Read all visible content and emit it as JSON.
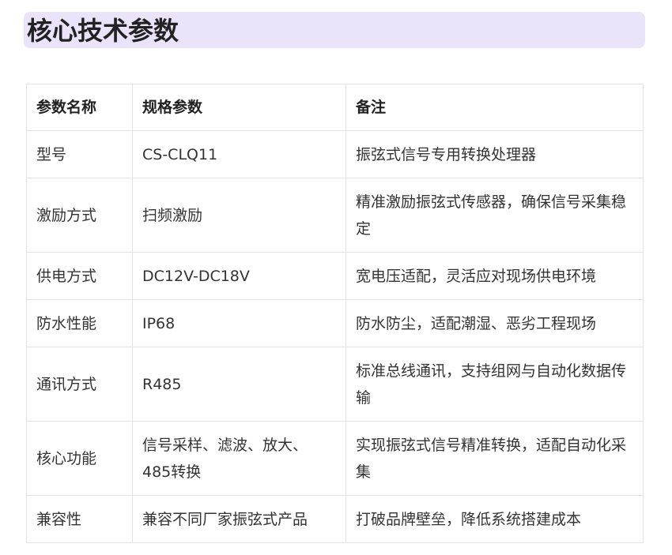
{
  "section": {
    "title": "核心技术参数"
  },
  "table": {
    "headers": [
      "参数名称",
      "规格参数",
      "备注"
    ],
    "rows": [
      {
        "name": "型号",
        "spec": "CS-CLQ11",
        "note": "振弦式信号专用转换处理器"
      },
      {
        "name": "激励方式",
        "spec": "扫频激励",
        "note": "精准激励振弦式传感器，确保信号采集稳定"
      },
      {
        "name": "供电方式",
        "spec": "DC12V-DC18V",
        "note": "宽电压适配，灵活应对现场供电环境"
      },
      {
        "name": "防水性能",
        "spec": "IP68",
        "note": "防水防尘，适配潮湿、恶劣工程现场"
      },
      {
        "name": "通讯方式",
        "spec": "R485",
        "note": "标准总线通讯，支持组网与自动化数据传输"
      },
      {
        "name": "核心功能",
        "spec": "信号采样、滤波、放大、485转换",
        "note": "实现振弦式信号精准转换，适配自动化采集"
      },
      {
        "name": "兼容性",
        "spec": "兼容不同厂家振弦式产品",
        "note": "打破品牌壁垒，降低系统搭建成本"
      }
    ]
  },
  "colors": {
    "heading_background": "#ebe3fa",
    "border": "#e3e3e3",
    "text": "#333333"
  }
}
